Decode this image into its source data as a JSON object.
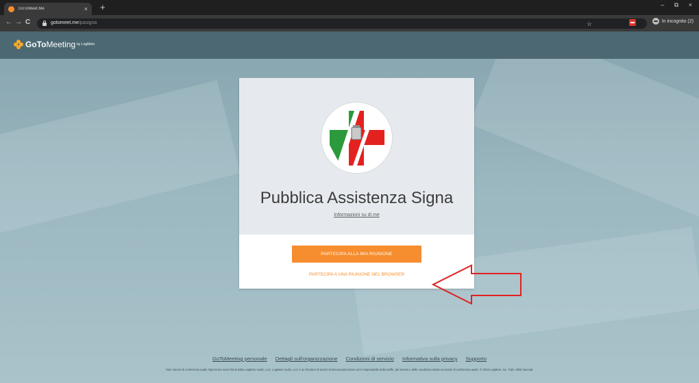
{
  "browser": {
    "tab_title": "GoToMeet.Me",
    "tab_close": "×",
    "new_tab": "+",
    "window_controls": "– ⧉ ×",
    "nav": {
      "back": "←",
      "forward": "→",
      "reload": "C"
    },
    "url_host": "gotomeet.me",
    "url_path": "/pasigna",
    "star": "☆",
    "incognito_label": "In incognito (2)"
  },
  "header": {
    "logo_goto": "GoTo",
    "logo_meeting": "Meeting",
    "logo_by": "by LogMeIn"
  },
  "card": {
    "org_name": "Pubblica Assistenza Signa",
    "about_link": "Informazioni su di me",
    "join_button": "PARTECIPA ALLA MIA RIUNIONE",
    "browser_link": "PARTECIPA A UNA RIUNIONE NEL BROWSER"
  },
  "footer": {
    "links": [
      "GoToMeeting personale",
      "Dettagli sull'organizzazione",
      "Condizioni di servizio",
      "Informativa sulla privacy",
      "Supporto"
    ],
    "legal": "Tutti i servizi di conferenza audio OpenVoice sono forniti dalla LogMeIn Audio, LLC. LogMeIn Audio, LLC è un fornitore di servizi di telecomunicazione ed è responsabile delle tariffe, dei termini e delle condizioni relativi ai servizi di conferenza audio. © 2019 LogMeIn, Inc. Tutti i diritti riservati."
  },
  "colors": {
    "accent": "#f68d2e",
    "header_bg": "#4c6872",
    "annotation_arrow": "#e02020"
  }
}
